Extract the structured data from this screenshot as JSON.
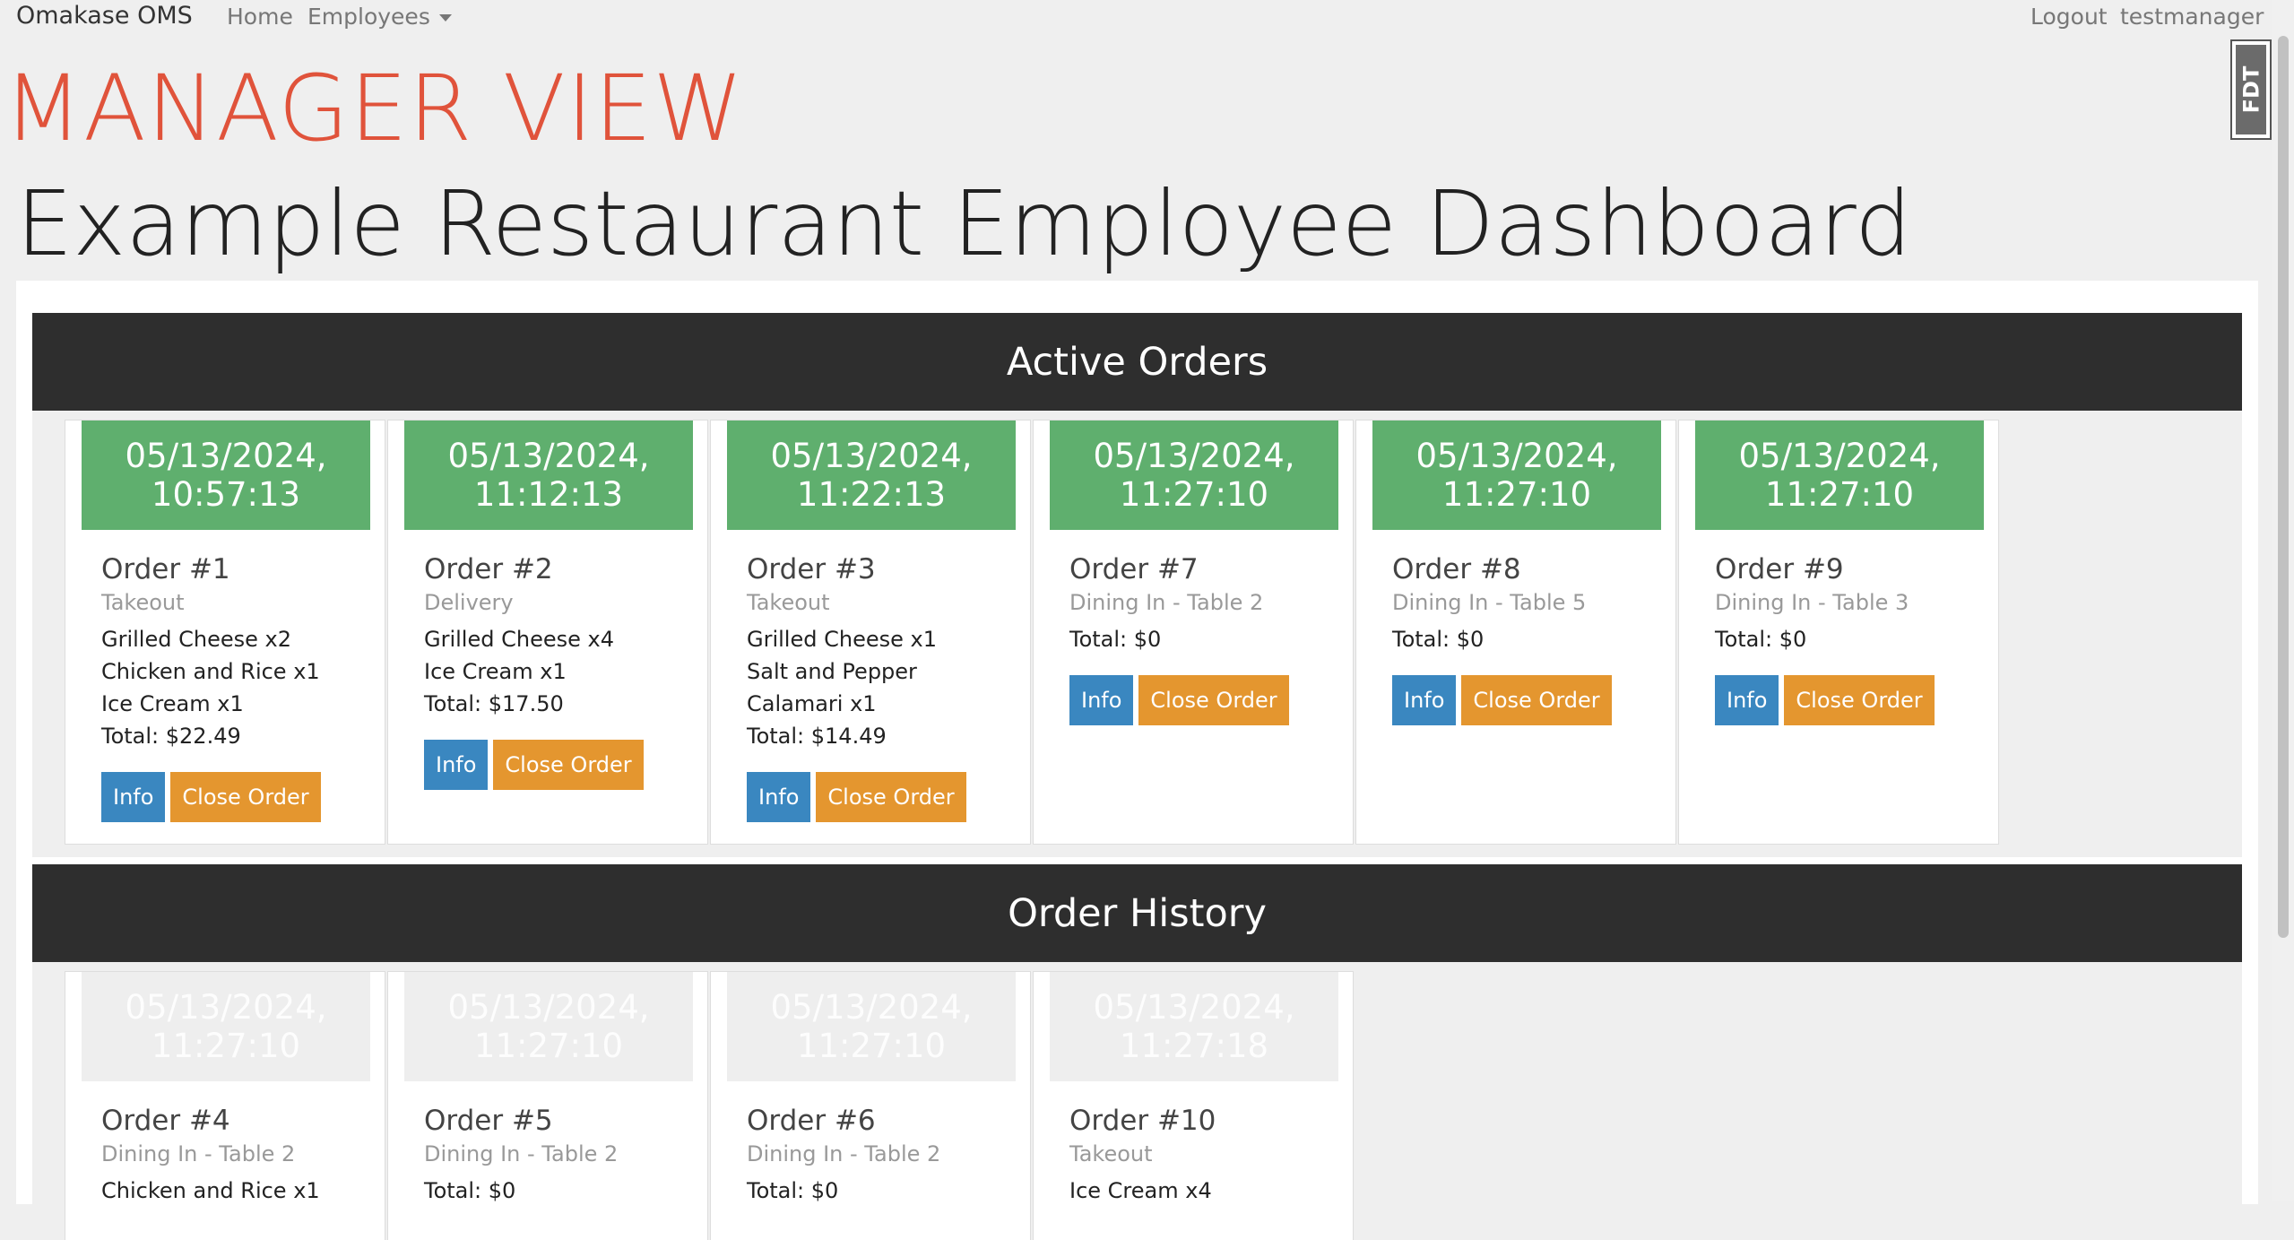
{
  "navbar": {
    "brand": "Omakase OMS",
    "home": "Home",
    "employees": "Employees",
    "logout": "Logout",
    "user": "testmanager"
  },
  "page": {
    "role_title": "MANAGER VIEW",
    "dashboard_title": "Example Restaurant Employee Dashboard"
  },
  "sections": {
    "active": "Active Orders",
    "history": "Order History"
  },
  "buttons": {
    "info": "Info",
    "close": "Close Order"
  },
  "fdt_label": "FDT",
  "colors": {
    "accent": "#e0533b",
    "active_header": "#5faf6e",
    "info": "#3a87c0",
    "close": "#e4962f",
    "section_bar": "#2e2e2e"
  },
  "active_orders": [
    {
      "date": "05/13/2024,",
      "time": "10:57:13",
      "title": "Order #1",
      "type": "Takeout",
      "lines": [
        "Grilled Cheese x2",
        "Chicken and Rice x1",
        "Ice Cream x1",
        "Total: $22.49"
      ]
    },
    {
      "date": "05/13/2024,",
      "time": "11:12:13",
      "title": "Order #2",
      "type": "Delivery",
      "lines": [
        "Grilled Cheese x4",
        "Ice Cream x1",
        "Total: $17.50"
      ]
    },
    {
      "date": "05/13/2024,",
      "time": "11:22:13",
      "title": "Order #3",
      "type": "Takeout",
      "lines": [
        "Grilled Cheese x1",
        "Salt and Pepper",
        "Calamari x1",
        "Total: $14.49"
      ]
    },
    {
      "date": "05/13/2024,",
      "time": "11:27:10",
      "title": "Order #7",
      "type": "Dining In - Table 2",
      "lines": [
        "Total: $0"
      ]
    },
    {
      "date": "05/13/2024,",
      "time": "11:27:10",
      "title": "Order #8",
      "type": "Dining In - Table 5",
      "lines": [
        "Total: $0"
      ]
    },
    {
      "date": "05/13/2024,",
      "time": "11:27:10",
      "title": "Order #9",
      "type": "Dining In - Table 3",
      "lines": [
        "Total: $0"
      ]
    }
  ],
  "history_orders": [
    {
      "date": "05/13/2024,",
      "time": "11:27:10",
      "title": "Order #4",
      "type": "Dining In - Table 2",
      "lines": [
        "Chicken and Rice x1"
      ]
    },
    {
      "date": "05/13/2024,",
      "time": "11:27:10",
      "title": "Order #5",
      "type": "Dining In - Table 2",
      "lines": [
        "Total: $0"
      ]
    },
    {
      "date": "05/13/2024,",
      "time": "11:27:10",
      "title": "Order #6",
      "type": "Dining In - Table 2",
      "lines": [
        "Total: $0"
      ]
    },
    {
      "date": "05/13/2024,",
      "time": "11:27:18",
      "title": "Order #10",
      "type": "Takeout",
      "lines": [
        "Ice Cream x4"
      ]
    }
  ]
}
